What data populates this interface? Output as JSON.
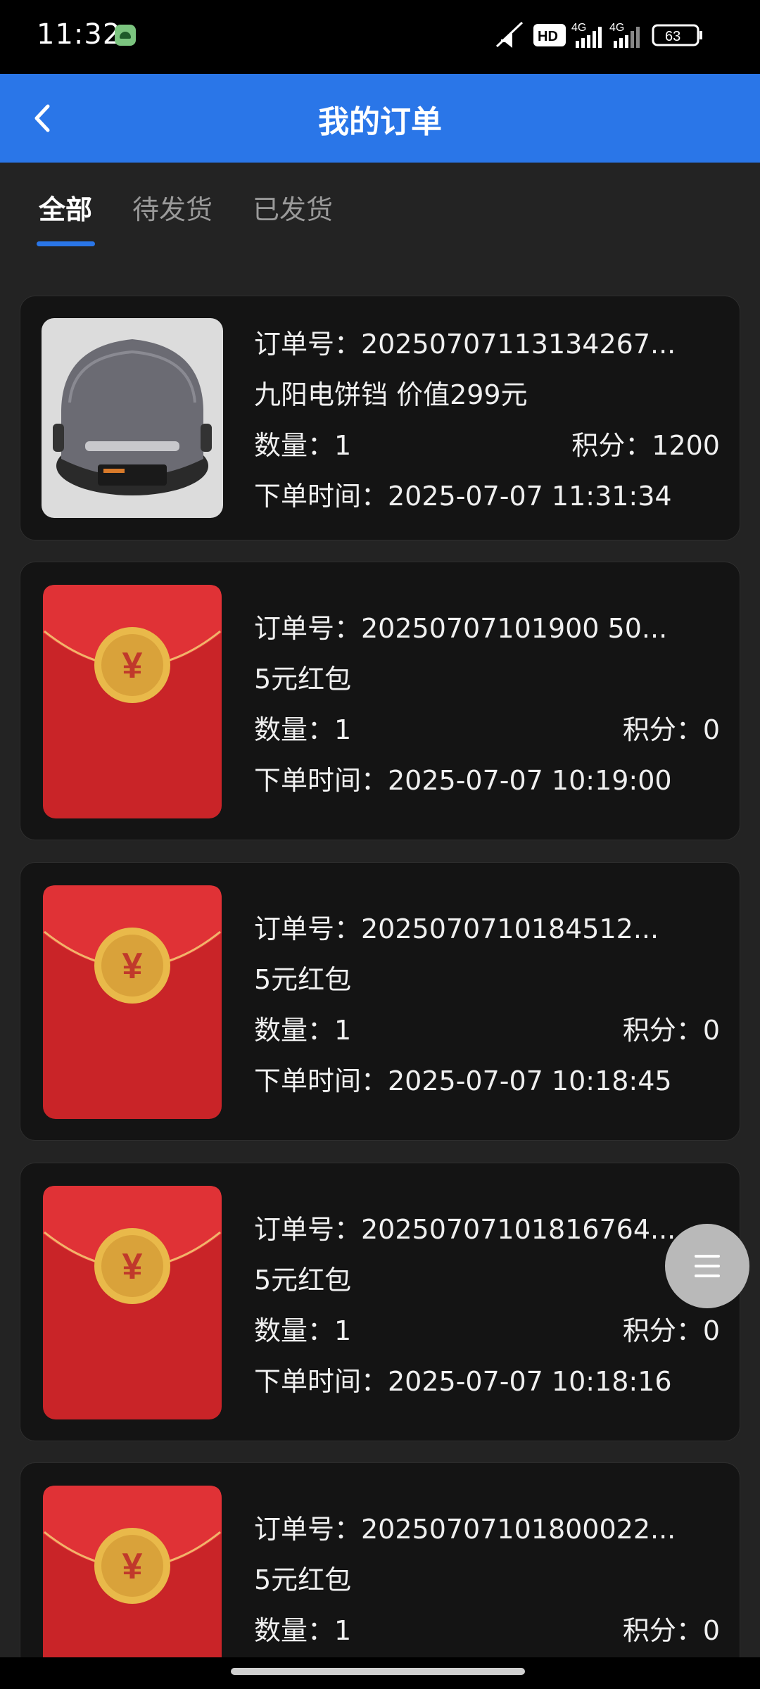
{
  "status_bar": {
    "time": "11:32",
    "network_1": "4G",
    "network_2": "4G",
    "hd_label": "HD",
    "battery": "63"
  },
  "header": {
    "title": "我的订单"
  },
  "tabs": [
    {
      "label": "全部",
      "active": true
    },
    {
      "label": "待发货",
      "active": false
    },
    {
      "label": "已发货",
      "active": false
    }
  ],
  "orders": [
    {
      "order_no": "订单号：20250707113134267...",
      "product": "九阳电饼铛 价值299元",
      "quantity": "数量：1",
      "points": "积分：1200",
      "time": "下单时间：2025-07-07 11:31:34",
      "image": "electric-griddle"
    },
    {
      "order_no": "订单号：20250707101900 50...",
      "product": "5元红包",
      "quantity": "数量：1",
      "points": "积分：0",
      "time": "下单时间：2025-07-07 10:19:00",
      "image": "red-envelope"
    },
    {
      "order_no": "订单号：2025070710184512...",
      "product": "5元红包",
      "quantity": "数量：1",
      "points": "积分：0",
      "time": "下单时间：2025-07-07 10:18:45",
      "image": "red-envelope"
    },
    {
      "order_no": "订单号：20250707101816764...",
      "product": "5元红包",
      "quantity": "数量：1",
      "points": "积分：0",
      "time": "下单时间：2025-07-07 10:18:16",
      "image": "red-envelope"
    },
    {
      "order_no": "订单号：20250707101800022...",
      "product": "5元红包",
      "quantity": "数量：1",
      "points": "积分：0",
      "image": "red-envelope"
    }
  ],
  "fab": {
    "icon": "menu-icon"
  },
  "colors": {
    "accent": "#2a76e8",
    "card_bg": "#141414",
    "page_bg": "#232323"
  }
}
